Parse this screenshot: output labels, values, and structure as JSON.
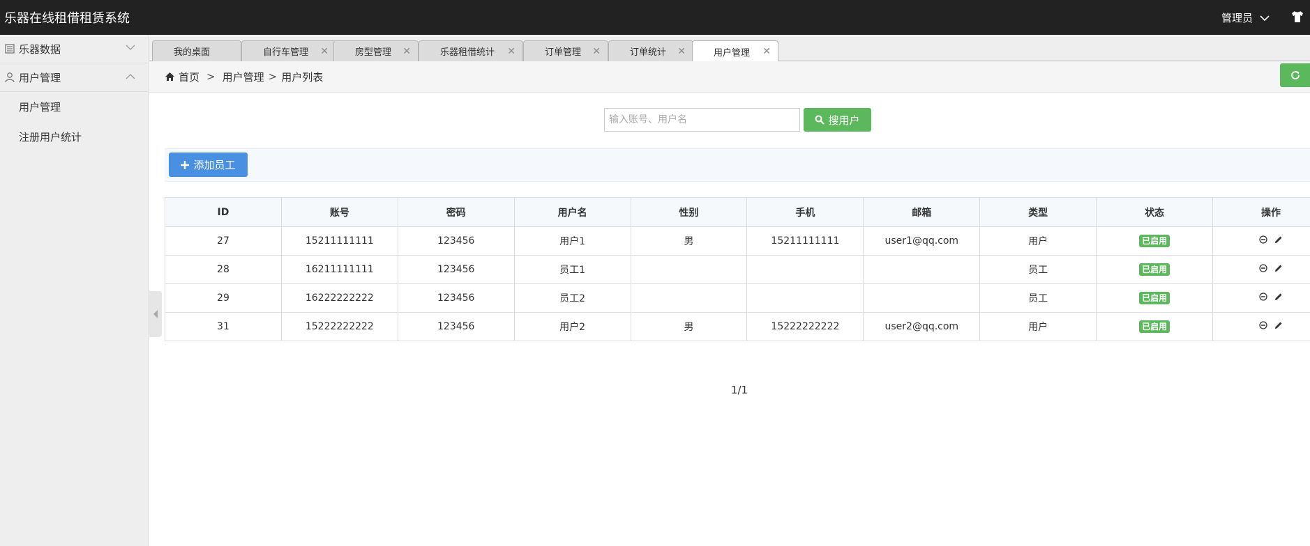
{
  "app": {
    "title": "乐器在线租借租赁系统",
    "user": "管理员"
  },
  "sidebar": {
    "groups": [
      {
        "label": "乐器数据"
      },
      {
        "label": "用户管理"
      }
    ],
    "items": [
      {
        "label": "用户管理"
      },
      {
        "label": "注册用户统计"
      }
    ]
  },
  "tabs": [
    {
      "label": "我的桌面"
    },
    {
      "label": "自行车管理"
    },
    {
      "label": "房型管理"
    },
    {
      "label": "乐器租借统计"
    },
    {
      "label": "订单管理"
    },
    {
      "label": "订单统计"
    },
    {
      "label": "用户管理"
    }
  ],
  "breadcrumb": {
    "home": "首页",
    "sep": ">",
    "level1": "用户管理",
    "level2": "用户列表"
  },
  "search": {
    "placeholder": "输入账号、用户名",
    "value": "",
    "button": "搜用户"
  },
  "toolbar": {
    "add_label": "添加员工"
  },
  "table": {
    "headers": [
      "ID",
      "账号",
      "密码",
      "用户名",
      "性别",
      "手机",
      "邮箱",
      "类型",
      "状态",
      "操作"
    ],
    "rows": [
      {
        "id": "27",
        "account": "15211111111",
        "password": "123456",
        "username": "用户1",
        "gender": "男",
        "phone": "15211111111",
        "email": "user1@qq.com",
        "type": "用户",
        "status": "已启用"
      },
      {
        "id": "28",
        "account": "16211111111",
        "password": "123456",
        "username": "员工1",
        "gender": "",
        "phone": "",
        "email": "",
        "type": "员工",
        "status": "已启用"
      },
      {
        "id": "29",
        "account": "16222222222",
        "password": "123456",
        "username": "员工2",
        "gender": "",
        "phone": "",
        "email": "",
        "type": "员工",
        "status": "已启用"
      },
      {
        "id": "31",
        "account": "15222222222",
        "password": "123456",
        "username": "用户2",
        "gender": "男",
        "phone": "15222222222",
        "email": "user2@qq.com",
        "type": "用户",
        "status": "已启用"
      }
    ]
  },
  "pagination": {
    "text": "1/1"
  },
  "colors": {
    "topbar": "#222222",
    "success": "#5cb85c",
    "primary": "#4a90e2"
  },
  "icons": [
    "list-icon",
    "user-icon",
    "chevron-down-icon",
    "chevron-up-icon",
    "close-icon",
    "home-icon",
    "refresh-icon",
    "search-icon",
    "plus-icon",
    "disable-icon",
    "pencil-icon",
    "shirt-icon",
    "caret-left-icon"
  ]
}
